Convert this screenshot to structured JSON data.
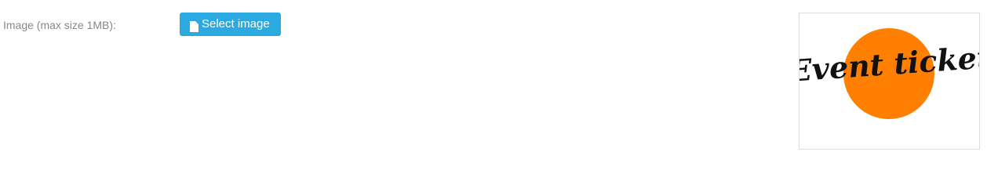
{
  "form": {
    "image_label": "Image (max size 1MB):",
    "select_button_label": "Select image",
    "select_button_icon": "file-icon"
  },
  "preview": {
    "logo_text": "Event ticket",
    "logo_circle_color": "#ff7f00",
    "logo_text_color": "#111111"
  },
  "colors": {
    "button_bg": "#2ba9e1",
    "label_text": "#888888",
    "preview_border": "#dddddd"
  }
}
